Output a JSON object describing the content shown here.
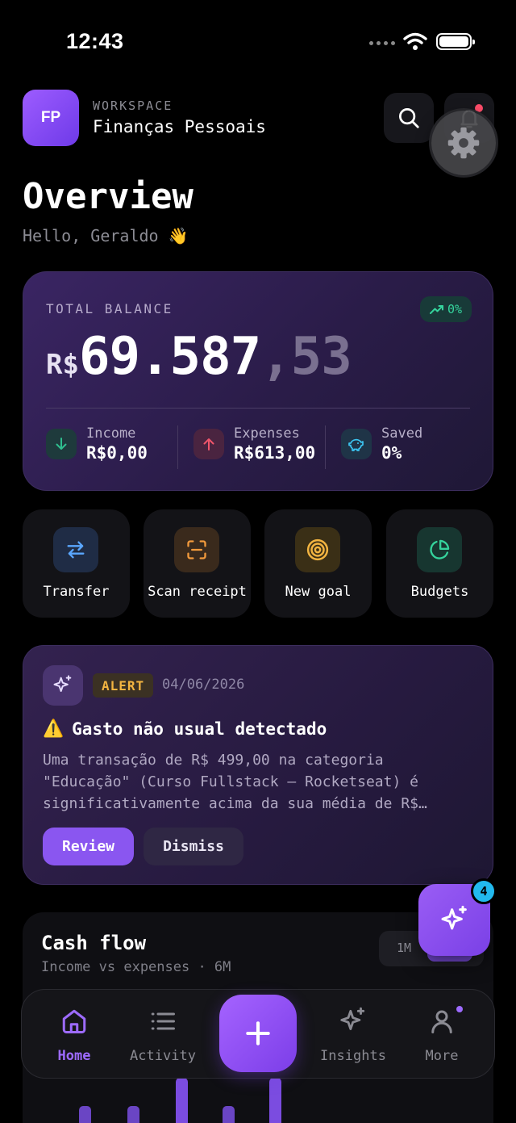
{
  "status_bar": {
    "time": "12:43"
  },
  "header": {
    "workspace_initials": "FP",
    "workspace_caption": "WORKSPACE",
    "workspace_name": "Finanças Pessoais",
    "search_icon": "search-icon",
    "bell_icon": "bell-icon",
    "settings_icon": "gear-icon"
  },
  "page": {
    "title": "Overview",
    "greeting": "Hello, Geraldo",
    "greeting_emoji": "👋"
  },
  "balance": {
    "label": "TOTAL BALANCE",
    "trend": "0%",
    "currency": "R$",
    "integer_part": "69.587",
    "decimal_part": ",53",
    "stats": [
      {
        "label": "Income",
        "value": "R$0,00",
        "icon": "arrow-down-icon",
        "color": "#2fbf8f"
      },
      {
        "label": "Expenses",
        "value": "R$613,00",
        "icon": "arrow-up-icon",
        "color": "#f0566b"
      },
      {
        "label": "Saved",
        "value": "0%",
        "icon": "piggy-bank-icon",
        "color": "#3cc6f2"
      }
    ]
  },
  "quick_actions": [
    {
      "label": "Transfer",
      "icon": "transfer-arrows-icon",
      "color": "#5aa7ff"
    },
    {
      "label": "Scan receipt",
      "icon": "scan-icon",
      "color": "#f29a3c"
    },
    {
      "label": "New goal",
      "icon": "target-icon",
      "color": "#f2b441"
    },
    {
      "label": "Budgets",
      "icon": "pie-chart-icon",
      "color": "#35d39c"
    }
  ],
  "alert": {
    "badge": "ALERT",
    "date": "04/06/2026",
    "title_emoji": "⚠️",
    "title": "Gasto não usual detectado",
    "body_lines": [
      "Uma transação de R$ 499,00 na categoria",
      "\"Educação\" (Curso Fullstack — Rocketseat) é",
      "significativamente acima da sua média de R$…"
    ],
    "review_label": "Review",
    "dismiss_label": "Dismiss"
  },
  "cash_flow": {
    "title": "Cash flow",
    "subtitle": "Income vs expenses · 6M",
    "range_option": "1M"
  },
  "ai_fab": {
    "badge_count": "4",
    "icon": "sparkles-icon"
  },
  "tab_bar": {
    "tabs": [
      {
        "label": "Home",
        "icon": "home-icon",
        "active": true
      },
      {
        "label": "Activity",
        "icon": "list-icon",
        "active": false
      },
      {
        "label": "Insights",
        "icon": "sparkles-icon",
        "active": false
      },
      {
        "label": "More",
        "icon": "user-icon",
        "active": false
      }
    ],
    "add_icon": "plus-icon"
  },
  "colors": {
    "accent": "#8a56f0",
    "background": "#000000",
    "card": "#131317"
  }
}
